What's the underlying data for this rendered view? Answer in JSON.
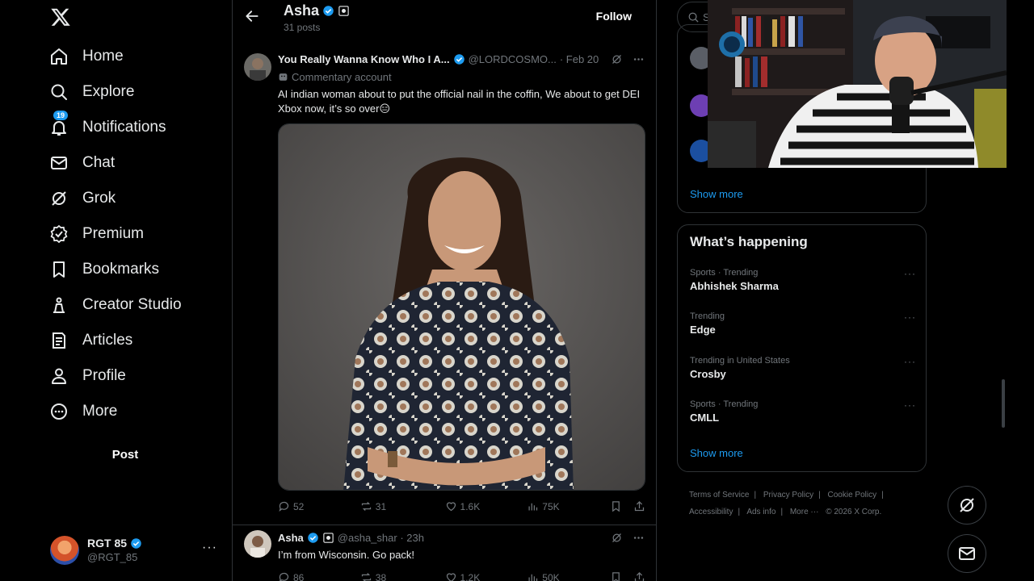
{
  "colors": {
    "bg": "#000000",
    "accent": "#1d9bf0",
    "text": "#e7e9ea",
    "muted": "#71767b",
    "border": "#2f3336"
  },
  "nav": {
    "logo_icon": "x-logo",
    "items": [
      {
        "label": "Home",
        "icon": "home-icon"
      },
      {
        "label": "Explore",
        "icon": "search-icon"
      },
      {
        "label": "Notifications",
        "icon": "bell-icon",
        "badge": "19"
      },
      {
        "label": "Chat",
        "icon": "mail-icon"
      },
      {
        "label": "Grok",
        "icon": "grok-icon"
      },
      {
        "label": "Premium",
        "icon": "premium-icon"
      },
      {
        "label": "Bookmarks",
        "icon": "bookmark-icon"
      },
      {
        "label": "Creator Studio",
        "icon": "creator-studio-icon"
      },
      {
        "label": "Articles",
        "icon": "articles-icon"
      },
      {
        "label": "Profile",
        "icon": "person-icon"
      },
      {
        "label": "More",
        "icon": "more-circle-icon"
      }
    ],
    "post_label": "Post",
    "account": {
      "name": "RGT 85",
      "handle": "@RGT_85",
      "more": "···"
    }
  },
  "header": {
    "title": "Asha",
    "posts_count": "31 posts",
    "follow_label": "Follow"
  },
  "tweets": [
    {
      "name": "You Really Wanna Know Who I A...",
      "handle": "@LORDCOSMO...",
      "time": "· Feb 20",
      "label": "Commentary account",
      "text": "AI indian woman about to put the official nail in the coffin, We about to get DEI Xbox now, it’s so over😑",
      "stats": {
        "replies": "52",
        "reposts": "31",
        "likes": "1.6K",
        "views": "75K"
      }
    },
    {
      "name": "Asha",
      "handle": "@asha_shar · 23h",
      "text": "I’m from Wisconsin. Go pack!",
      "stats": {
        "replies": "86",
        "reposts": "38",
        "likes": "1.2K",
        "views": "50K"
      }
    }
  ],
  "right": {
    "search_placeholder": "S",
    "show_more": "Show more",
    "whats_happening": "What’s happening",
    "trends": [
      {
        "category": "Sports · Trending",
        "name": "Abhishek Sharma"
      },
      {
        "category": "Trending",
        "name": "Edge"
      },
      {
        "category": "Trending in United States",
        "name": "Crosby"
      },
      {
        "category": "Sports · Trending",
        "name": "CMLL"
      }
    ],
    "footer": [
      "Terms of Service",
      "|",
      "Privacy Policy",
      "|",
      "Cookie Policy",
      "|",
      "Accessibility",
      "|",
      "Ads info",
      "|",
      "More ···",
      "© 2026 X Corp."
    ]
  }
}
